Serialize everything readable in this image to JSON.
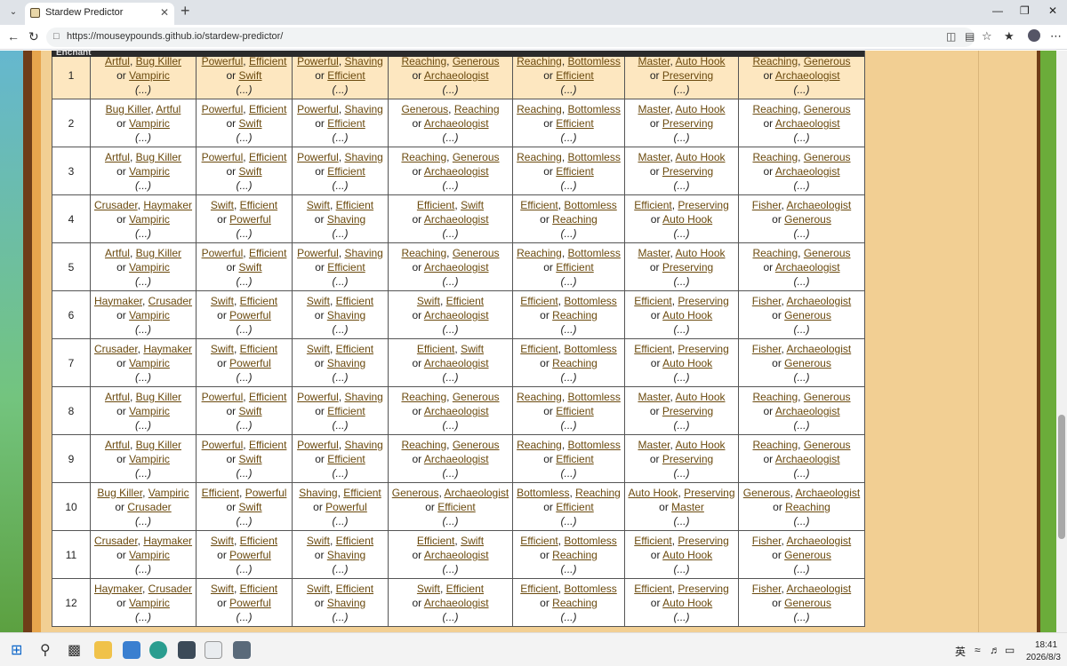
{
  "browser": {
    "tab_title": "Stardew Predictor",
    "url": "https://mouseypounds.github.io/stardew-predictor/",
    "icons": [
      "tab-list-icon",
      "close-tab-icon",
      "new-tab-icon",
      "minimize-icon",
      "restore-icon",
      "close-window-icon",
      "back-icon",
      "reload-icon",
      "lock-icon",
      "translate-icon",
      "reader-icon",
      "favorite-icon",
      "collections-icon",
      "profile-icon",
      "menu-icon"
    ]
  },
  "table": {
    "header_partial": "Enchant",
    "highlight_row": 0,
    "more_text": "(...)",
    "or_text": "or",
    "rows": [
      {
        "num": "1",
        "cells": [
          [
            "Artful",
            "Bug Killer",
            "Vampiric"
          ],
          [
            "Powerful",
            "Efficient",
            "Swift"
          ],
          [
            "Powerful",
            "Shaving",
            "Efficient"
          ],
          [
            "Reaching",
            "Generous",
            "Archaeologist"
          ],
          [
            "Reaching",
            "Bottomless",
            "Efficient"
          ],
          [
            "Master",
            "Auto Hook",
            "Preserving"
          ],
          [
            "Reaching",
            "Generous",
            "Archaeologist"
          ]
        ]
      },
      {
        "num": "2",
        "cells": [
          [
            "Bug Killer",
            "Artful",
            "Vampiric"
          ],
          [
            "Powerful",
            "Efficient",
            "Swift"
          ],
          [
            "Powerful",
            "Shaving",
            "Efficient"
          ],
          [
            "Generous",
            "Reaching",
            "Archaeologist"
          ],
          [
            "Reaching",
            "Bottomless",
            "Efficient"
          ],
          [
            "Master",
            "Auto Hook",
            "Preserving"
          ],
          [
            "Reaching",
            "Generous",
            "Archaeologist"
          ]
        ]
      },
      {
        "num": "3",
        "cells": [
          [
            "Artful",
            "Bug Killer",
            "Vampiric"
          ],
          [
            "Powerful",
            "Efficient",
            "Swift"
          ],
          [
            "Powerful",
            "Shaving",
            "Efficient"
          ],
          [
            "Reaching",
            "Generous",
            "Archaeologist"
          ],
          [
            "Reaching",
            "Bottomless",
            "Efficient"
          ],
          [
            "Master",
            "Auto Hook",
            "Preserving"
          ],
          [
            "Reaching",
            "Generous",
            "Archaeologist"
          ]
        ]
      },
      {
        "num": "4",
        "cells": [
          [
            "Crusader",
            "Haymaker",
            "Vampiric"
          ],
          [
            "Swift",
            "Efficient",
            "Powerful"
          ],
          [
            "Swift",
            "Efficient",
            "Shaving"
          ],
          [
            "Efficient",
            "Swift",
            "Archaeologist"
          ],
          [
            "Efficient",
            "Bottomless",
            "Reaching"
          ],
          [
            "Efficient",
            "Preserving",
            "Auto Hook"
          ],
          [
            "Fisher",
            "Archaeologist",
            "Generous"
          ]
        ]
      },
      {
        "num": "5",
        "cells": [
          [
            "Artful",
            "Bug Killer",
            "Vampiric"
          ],
          [
            "Powerful",
            "Efficient",
            "Swift"
          ],
          [
            "Powerful",
            "Shaving",
            "Efficient"
          ],
          [
            "Reaching",
            "Generous",
            "Archaeologist"
          ],
          [
            "Reaching",
            "Bottomless",
            "Efficient"
          ],
          [
            "Master",
            "Auto Hook",
            "Preserving"
          ],
          [
            "Reaching",
            "Generous",
            "Archaeologist"
          ]
        ]
      },
      {
        "num": "6",
        "cells": [
          [
            "Haymaker",
            "Crusader",
            "Vampiric"
          ],
          [
            "Swift",
            "Efficient",
            "Powerful"
          ],
          [
            "Swift",
            "Efficient",
            "Shaving"
          ],
          [
            "Swift",
            "Efficient",
            "Archaeologist"
          ],
          [
            "Efficient",
            "Bottomless",
            "Reaching"
          ],
          [
            "Efficient",
            "Preserving",
            "Auto Hook"
          ],
          [
            "Fisher",
            "Archaeologist",
            "Generous"
          ]
        ]
      },
      {
        "num": "7",
        "cells": [
          [
            "Crusader",
            "Haymaker",
            "Vampiric"
          ],
          [
            "Swift",
            "Efficient",
            "Powerful"
          ],
          [
            "Swift",
            "Efficient",
            "Shaving"
          ],
          [
            "Efficient",
            "Swift",
            "Archaeologist"
          ],
          [
            "Efficient",
            "Bottomless",
            "Reaching"
          ],
          [
            "Efficient",
            "Preserving",
            "Auto Hook"
          ],
          [
            "Fisher",
            "Archaeologist",
            "Generous"
          ]
        ]
      },
      {
        "num": "8",
        "cells": [
          [
            "Artful",
            "Bug Killer",
            "Vampiric"
          ],
          [
            "Powerful",
            "Efficient",
            "Swift"
          ],
          [
            "Powerful",
            "Shaving",
            "Efficient"
          ],
          [
            "Reaching",
            "Generous",
            "Archaeologist"
          ],
          [
            "Reaching",
            "Bottomless",
            "Efficient"
          ],
          [
            "Master",
            "Auto Hook",
            "Preserving"
          ],
          [
            "Reaching",
            "Generous",
            "Archaeologist"
          ]
        ]
      },
      {
        "num": "9",
        "cells": [
          [
            "Artful",
            "Bug Killer",
            "Vampiric"
          ],
          [
            "Powerful",
            "Efficient",
            "Swift"
          ],
          [
            "Powerful",
            "Shaving",
            "Efficient"
          ],
          [
            "Reaching",
            "Generous",
            "Archaeologist"
          ],
          [
            "Reaching",
            "Bottomless",
            "Efficient"
          ],
          [
            "Master",
            "Auto Hook",
            "Preserving"
          ],
          [
            "Reaching",
            "Generous",
            "Archaeologist"
          ]
        ]
      },
      {
        "num": "10",
        "cells": [
          [
            "Bug Killer",
            "Vampiric",
            "Crusader"
          ],
          [
            "Efficient",
            "Powerful",
            "Swift"
          ],
          [
            "Shaving",
            "Efficient",
            "Powerful"
          ],
          [
            "Generous",
            "Archaeologist",
            "Efficient"
          ],
          [
            "Bottomless",
            "Reaching",
            "Efficient"
          ],
          [
            "Auto Hook",
            "Preserving",
            "Master"
          ],
          [
            "Generous",
            "Archaeologist",
            "Reaching"
          ]
        ]
      },
      {
        "num": "11",
        "cells": [
          [
            "Crusader",
            "Haymaker",
            "Vampiric"
          ],
          [
            "Swift",
            "Efficient",
            "Powerful"
          ],
          [
            "Swift",
            "Efficient",
            "Shaving"
          ],
          [
            "Efficient",
            "Swift",
            "Archaeologist"
          ],
          [
            "Efficient",
            "Bottomless",
            "Reaching"
          ],
          [
            "Efficient",
            "Preserving",
            "Auto Hook"
          ],
          [
            "Fisher",
            "Archaeologist",
            "Generous"
          ]
        ]
      },
      {
        "num": "12",
        "cells": [
          [
            "Haymaker",
            "Crusader",
            "Vampiric"
          ],
          [
            "Swift",
            "Efficient",
            "Powerful"
          ],
          [
            "Swift",
            "Efficient",
            "Shaving"
          ],
          [
            "Swift",
            "Efficient",
            "Archaeologist"
          ],
          [
            "Efficient",
            "Bottomless",
            "Reaching"
          ],
          [
            "Efficient",
            "Preserving",
            "Auto Hook"
          ],
          [
            "Fisher",
            "Archaeologist",
            "Generous"
          ]
        ]
      }
    ]
  },
  "taskbar": {
    "ime": "英",
    "time": "18:41",
    "date": "2026/8/3"
  }
}
